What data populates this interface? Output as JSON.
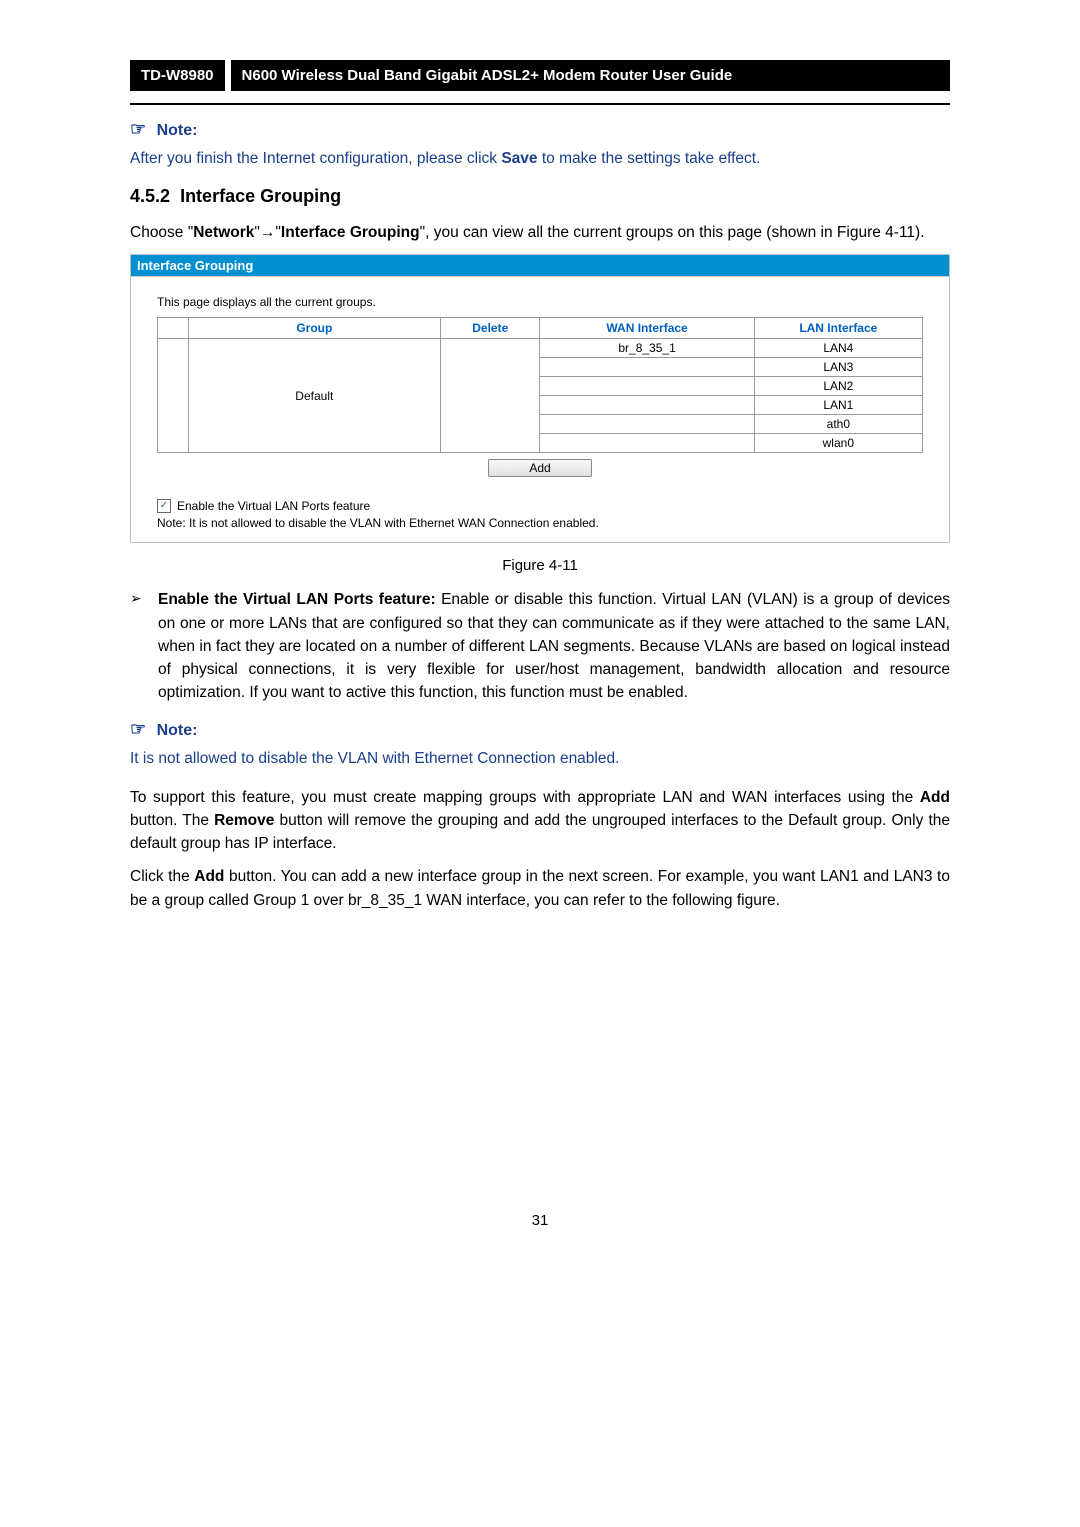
{
  "header": {
    "model": "TD-W8980",
    "title": "N600 Wireless Dual Band Gigabit ADSL2+ Modem Router User Guide"
  },
  "note1": {
    "label": "Note:",
    "text_a": "After you finish the Internet configuration, please click ",
    "text_bold": "Save",
    "text_b": " to make the settings take effect."
  },
  "section": {
    "number": "4.5.2",
    "title": "Interface Grouping"
  },
  "intro": {
    "p1a": "Choose \"",
    "p1b": "Network",
    "p1c": "\"",
    "arrow": "→",
    "p1d": "\"",
    "p1e": "Interface Grouping",
    "p1f": "\", you can view all the current groups on this page (shown in Figure 4-11)."
  },
  "panel": {
    "title": "Interface Grouping",
    "desc": "This page displays all the current groups.",
    "headers": {
      "c1": "",
      "c2": "Group",
      "c3": "Delete",
      "c4": "WAN Interface",
      "c5": "LAN Interface"
    },
    "default_group": "Default",
    "wan": [
      "br_8_35_1",
      "",
      "",
      "",
      "",
      ""
    ],
    "lan": [
      "LAN4",
      "LAN3",
      "LAN2",
      "LAN1",
      "ath0",
      "wlan0"
    ],
    "add_label": "Add",
    "vlan_label": "Enable the Virtual LAN Ports feature",
    "vlan_note": "Note: It is not allowed to disable the VLAN with Ethernet WAN Connection enabled."
  },
  "figure_caption": "Figure 4-11",
  "bullet": {
    "lead_bold": "Enable the Virtual LAN Ports feature:",
    "text": " Enable or disable this function. Virtual LAN (VLAN) is a group of devices on one or more LANs that are configured so that they can communicate as if they were attached to the same LAN, when in fact they are located on a number of different LAN segments. Because VLANs are based on logical instead of physical connections, it is very flexible for user/host management, bandwidth allocation and resource optimization. If you want to active this function, this function must be enabled."
  },
  "note2": {
    "label": "Note:",
    "text": "It is not allowed to disable the VLAN with Ethernet Connection enabled."
  },
  "para2": {
    "a": "To support this feature, you must create mapping groups with appropriate LAN and WAN interfaces using the ",
    "b": "Add",
    "c": " button. The ",
    "d": "Remove",
    "e": " button will remove the grouping and add the ungrouped interfaces to the Default group. Only the default group has IP interface."
  },
  "para3": {
    "a": "Click the ",
    "b": "Add",
    "c": " button. You can add a new interface group in the next screen. For example, you want LAN1 and LAN3 to be a group called Group 1 over br_8_35_1 WAN interface, you can refer to the following figure."
  },
  "page_number": "31"
}
